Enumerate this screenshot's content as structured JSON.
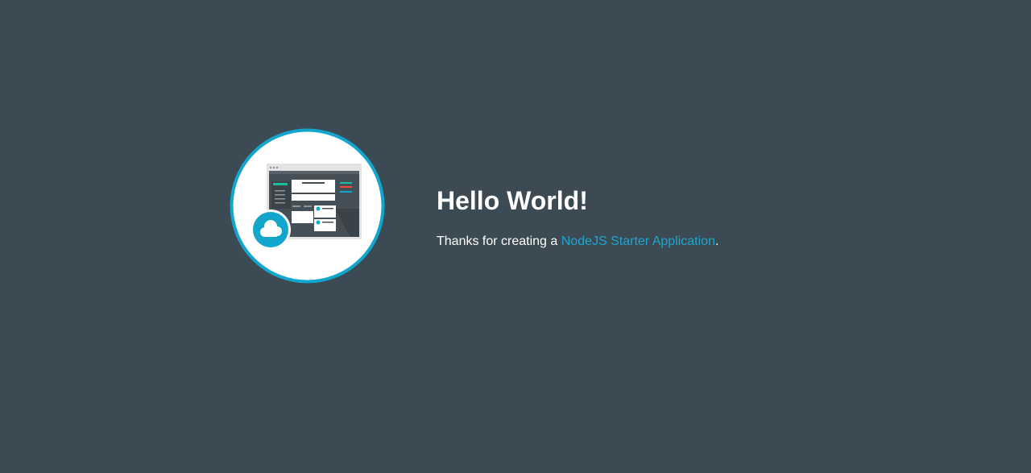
{
  "colors": {
    "background": "#3b4a53",
    "accent": "#1fa6cf",
    "heading": "#ffffff",
    "body_text": "#ffffff"
  },
  "logo": {
    "icon": "app-window-cloud-icon"
  },
  "heading": "Hello World!",
  "message": {
    "prefix": "Thanks for creating a ",
    "link_text": "NodeJS Starter Application",
    "suffix": "."
  }
}
